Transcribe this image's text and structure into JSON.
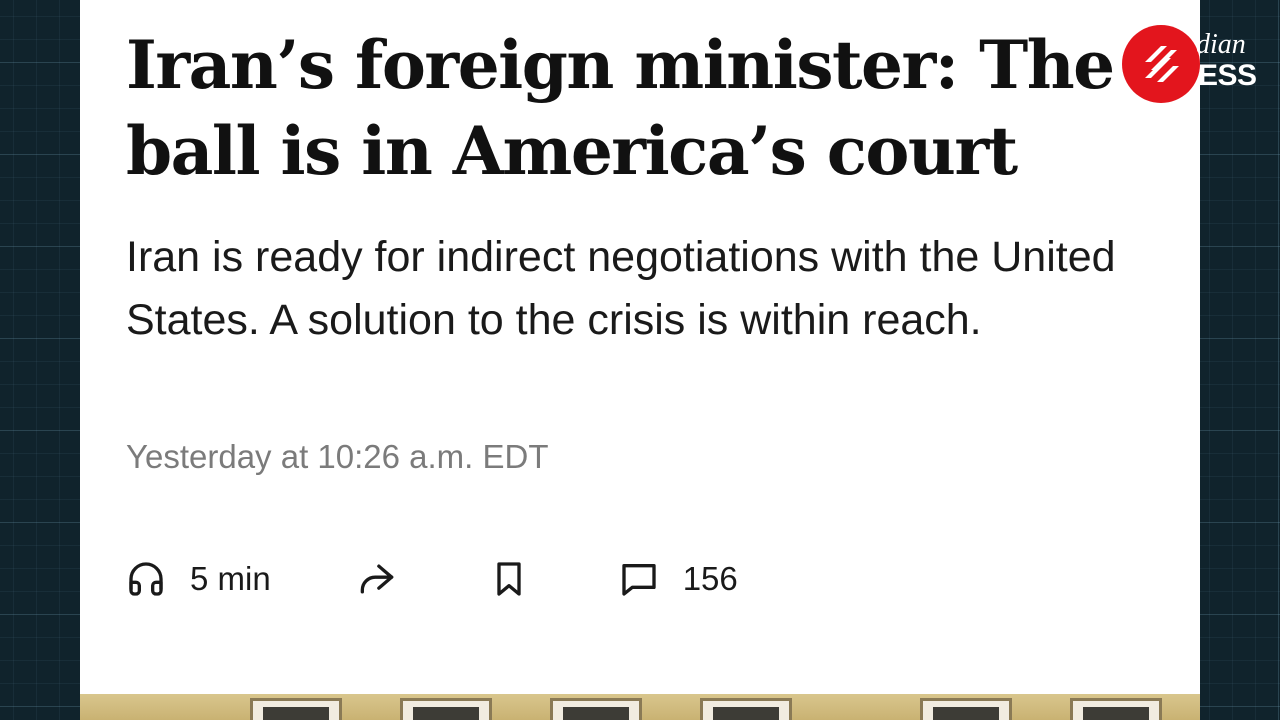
{
  "article": {
    "headline": "Iran’s foreign minister: The ball is in America’s court",
    "dek": "Iran is ready for indirect negotiations with the United States. A solution to the crisis is within reach.",
    "timestamp": "Yesterday at 10:26 a.m. EDT"
  },
  "actions": {
    "listen_label": "5 min",
    "comment_count": "156",
    "icons": [
      "headphones-icon",
      "share-icon",
      "bookmark-icon",
      "comment-icon"
    ]
  },
  "brand": {
    "line1": "dian",
    "line2": "ESS",
    "logo_color": "#e3151d"
  }
}
